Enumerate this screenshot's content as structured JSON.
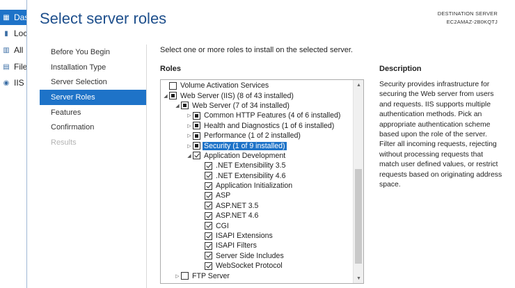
{
  "background_nav": {
    "items": [
      {
        "label": "Das",
        "icon": "dashboard-icon",
        "active": true
      },
      {
        "label": "Loc",
        "icon": "local-server-icon",
        "active": false
      },
      {
        "label": "All",
        "icon": "all-servers-icon",
        "active": false
      },
      {
        "label": "File",
        "icon": "file-services-icon",
        "active": false
      },
      {
        "label": "IIS",
        "icon": "iis-icon",
        "active": false
      }
    ]
  },
  "wizard": {
    "title": "Select server roles",
    "destination_label": "DESTINATION SERVER",
    "destination_server": "EC2AMAZ-2B0KQTJ",
    "instruction": "Select one or more roles to install on the selected server.",
    "roles_heading": "Roles",
    "description_heading": "Description",
    "description_text": "Security provides infrastructure for securing the Web server from users and requests. IIS supports multiple authentication methods. Pick an appropriate authentication scheme based upon the role of the server. Filter all incoming requests, rejecting without processing requests that match user defined values, or restrict requests based on originating address space."
  },
  "nav": {
    "items": [
      {
        "label": "Before You Begin",
        "state": "normal"
      },
      {
        "label": "Installation Type",
        "state": "normal"
      },
      {
        "label": "Server Selection",
        "state": "normal"
      },
      {
        "label": "Server Roles",
        "state": "selected"
      },
      {
        "label": "Features",
        "state": "normal"
      },
      {
        "label": "Confirmation",
        "state": "normal"
      },
      {
        "label": "Results",
        "state": "disabled"
      }
    ]
  },
  "roles_tree": [
    {
      "label": "Volume Activation Services",
      "level": 0,
      "expander": "",
      "check": "unchecked"
    },
    {
      "label": "Web Server (IIS) (8 of 43 installed)",
      "level": 0,
      "expander": "expanded",
      "check": "partial"
    },
    {
      "label": "Web Server (7 of 34 installed)",
      "level": 1,
      "expander": "expanded",
      "check": "partial"
    },
    {
      "label": "Common HTTP Features (4 of 6 installed)",
      "level": 2,
      "expander": "collapsed",
      "check": "partial"
    },
    {
      "label": "Health and Diagnostics (1 of 6 installed)",
      "level": 2,
      "expander": "collapsed",
      "check": "partial"
    },
    {
      "label": "Performance (1 of 2 installed)",
      "level": 2,
      "expander": "collapsed",
      "check": "partial"
    },
    {
      "label": "Security (1 of 9 installed)",
      "level": 2,
      "expander": "collapsed",
      "check": "partial",
      "highlight": true
    },
    {
      "label": "Application Development",
      "level": 2,
      "expander": "expanded",
      "check": "checked"
    },
    {
      "label": ".NET Extensibility 3.5",
      "level": 3,
      "expander": "",
      "check": "checked"
    },
    {
      "label": ".NET Extensibility 4.6",
      "level": 3,
      "expander": "",
      "check": "checked"
    },
    {
      "label": "Application Initialization",
      "level": 3,
      "expander": "",
      "check": "checked"
    },
    {
      "label": "ASP",
      "level": 3,
      "expander": "",
      "check": "checked"
    },
    {
      "label": "ASP.NET 3.5",
      "level": 3,
      "expander": "",
      "check": "checked"
    },
    {
      "label": "ASP.NET 4.6",
      "level": 3,
      "expander": "",
      "check": "checked"
    },
    {
      "label": "CGI",
      "level": 3,
      "expander": "",
      "check": "checked"
    },
    {
      "label": "ISAPI Extensions",
      "level": 3,
      "expander": "",
      "check": "checked"
    },
    {
      "label": "ISAPI Filters",
      "level": 3,
      "expander": "",
      "check": "checked"
    },
    {
      "label": "Server Side Includes",
      "level": 3,
      "expander": "",
      "check": "checked"
    },
    {
      "label": "WebSocket Protocol",
      "level": 3,
      "expander": "",
      "check": "checked"
    },
    {
      "label": "FTP Server",
      "level": 1,
      "expander": "collapsed",
      "check": "unchecked"
    }
  ],
  "colors": {
    "accent": "#1e73c8",
    "title": "#1e4f8c"
  }
}
